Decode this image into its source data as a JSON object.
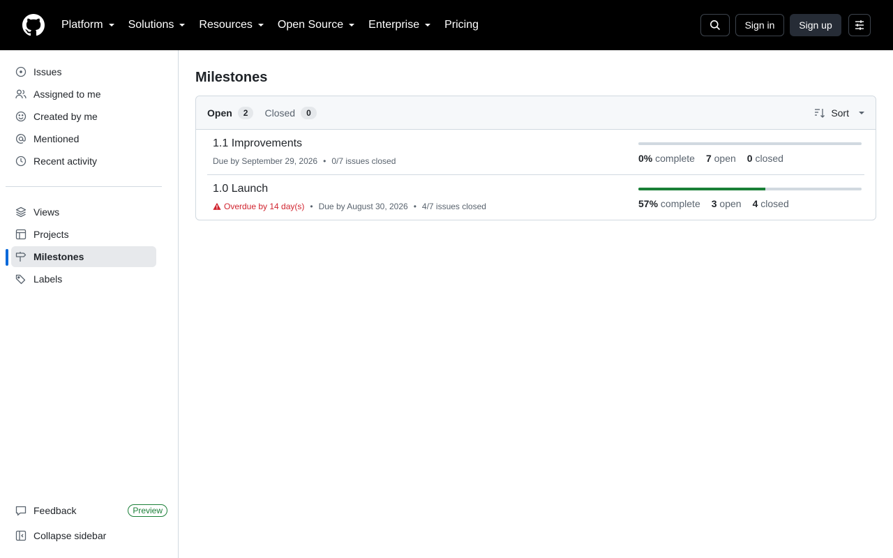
{
  "header": {
    "nav": [
      {
        "label": "Platform",
        "caret": true
      },
      {
        "label": "Solutions",
        "caret": true
      },
      {
        "label": "Resources",
        "caret": true
      },
      {
        "label": "Open Source",
        "caret": true
      },
      {
        "label": "Enterprise",
        "caret": true
      },
      {
        "label": "Pricing",
        "caret": false
      }
    ],
    "sign_in": "Sign in",
    "sign_up": "Sign up"
  },
  "sidebar": {
    "top_items": [
      {
        "label": "Issues",
        "icon": "issue-opened-icon"
      },
      {
        "label": "Assigned to me",
        "icon": "people-icon"
      },
      {
        "label": "Created by me",
        "icon": "smiley-icon"
      },
      {
        "label": "Mentioned",
        "icon": "mention-icon"
      },
      {
        "label": "Recent activity",
        "icon": "clock-icon"
      }
    ],
    "bottom_items": [
      {
        "label": "Views",
        "icon": "stack-icon"
      },
      {
        "label": "Projects",
        "icon": "table-icon"
      },
      {
        "label": "Milestones",
        "icon": "milestone-icon",
        "active": true
      },
      {
        "label": "Labels",
        "icon": "tag-icon"
      }
    ],
    "feedback": "Feedback",
    "preview_badge": "Preview",
    "collapse": "Collapse sidebar"
  },
  "main": {
    "title": "Milestones",
    "tabs": {
      "open_label": "Open",
      "open_count": "2",
      "closed_label": "Closed",
      "closed_count": "0"
    },
    "sort_label": "Sort",
    "milestones": [
      {
        "title": "1.1 Improvements",
        "overdue": "",
        "due": "Due by September 29, 2026",
        "issues_closed": "0/7 issues closed",
        "progress": 0,
        "percent": "0%",
        "complete_label": "complete",
        "open_count": "7",
        "open_label": "open",
        "closed_count": "0",
        "closed_label": "closed"
      },
      {
        "title": "1.0 Launch",
        "overdue": "Overdue by 14 day(s)",
        "due": "Due by August 30, 2026",
        "issues_closed": "4/7 issues closed",
        "progress": 0.57,
        "percent": "57%",
        "complete_label": "complete",
        "open_count": "3",
        "open_label": "open",
        "closed_count": "4",
        "closed_label": "closed"
      }
    ],
    "colors": {
      "progress_fill": "#1a7f37",
      "overdue": "#d1242f",
      "accent": "#0969da"
    }
  }
}
